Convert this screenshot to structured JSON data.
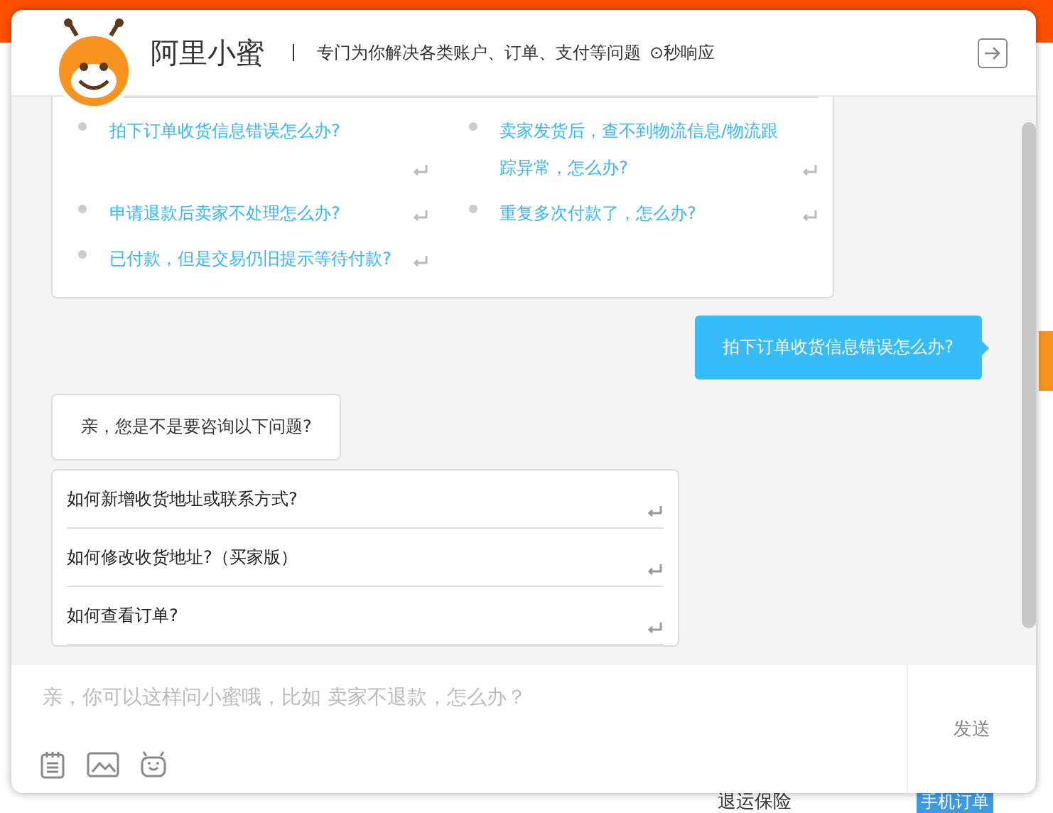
{
  "window": {
    "title": "阿里小蜜",
    "subtitle": "专门为你解决各类账户、订单、支付等问题",
    "badge": "⊙秒响应"
  },
  "chat": {
    "messages": [
      {
        "kind": "faq_card",
        "items": [
          "拍下订单收货信息错误怎么办?",
          "卖家发货后，查不到物流信息/物流跟踪异常，怎么办?",
          "申请退款后卖家不处理怎么办?",
          "重复多次付款了，怎么办?",
          "已付款，但是交易仍旧提示等待付款?"
        ]
      },
      {
        "kind": "user",
        "text": "拍下订单收货信息错误怎么办?"
      },
      {
        "kind": "bot",
        "text": "亲，您是不是要咨询以下问题?"
      },
      {
        "kind": "options",
        "items": [
          "如何新增收货地址或联系方式?",
          "如何修改收货地址?（买家版）",
          "如何查看订单?"
        ]
      }
    ]
  },
  "composer": {
    "placeholder": "亲，你可以这样问小蜜哦，比如 卖家不退款，怎么办？",
    "send": "发送"
  },
  "background": {
    "label": "退运保险",
    "tag": "手机订单"
  }
}
